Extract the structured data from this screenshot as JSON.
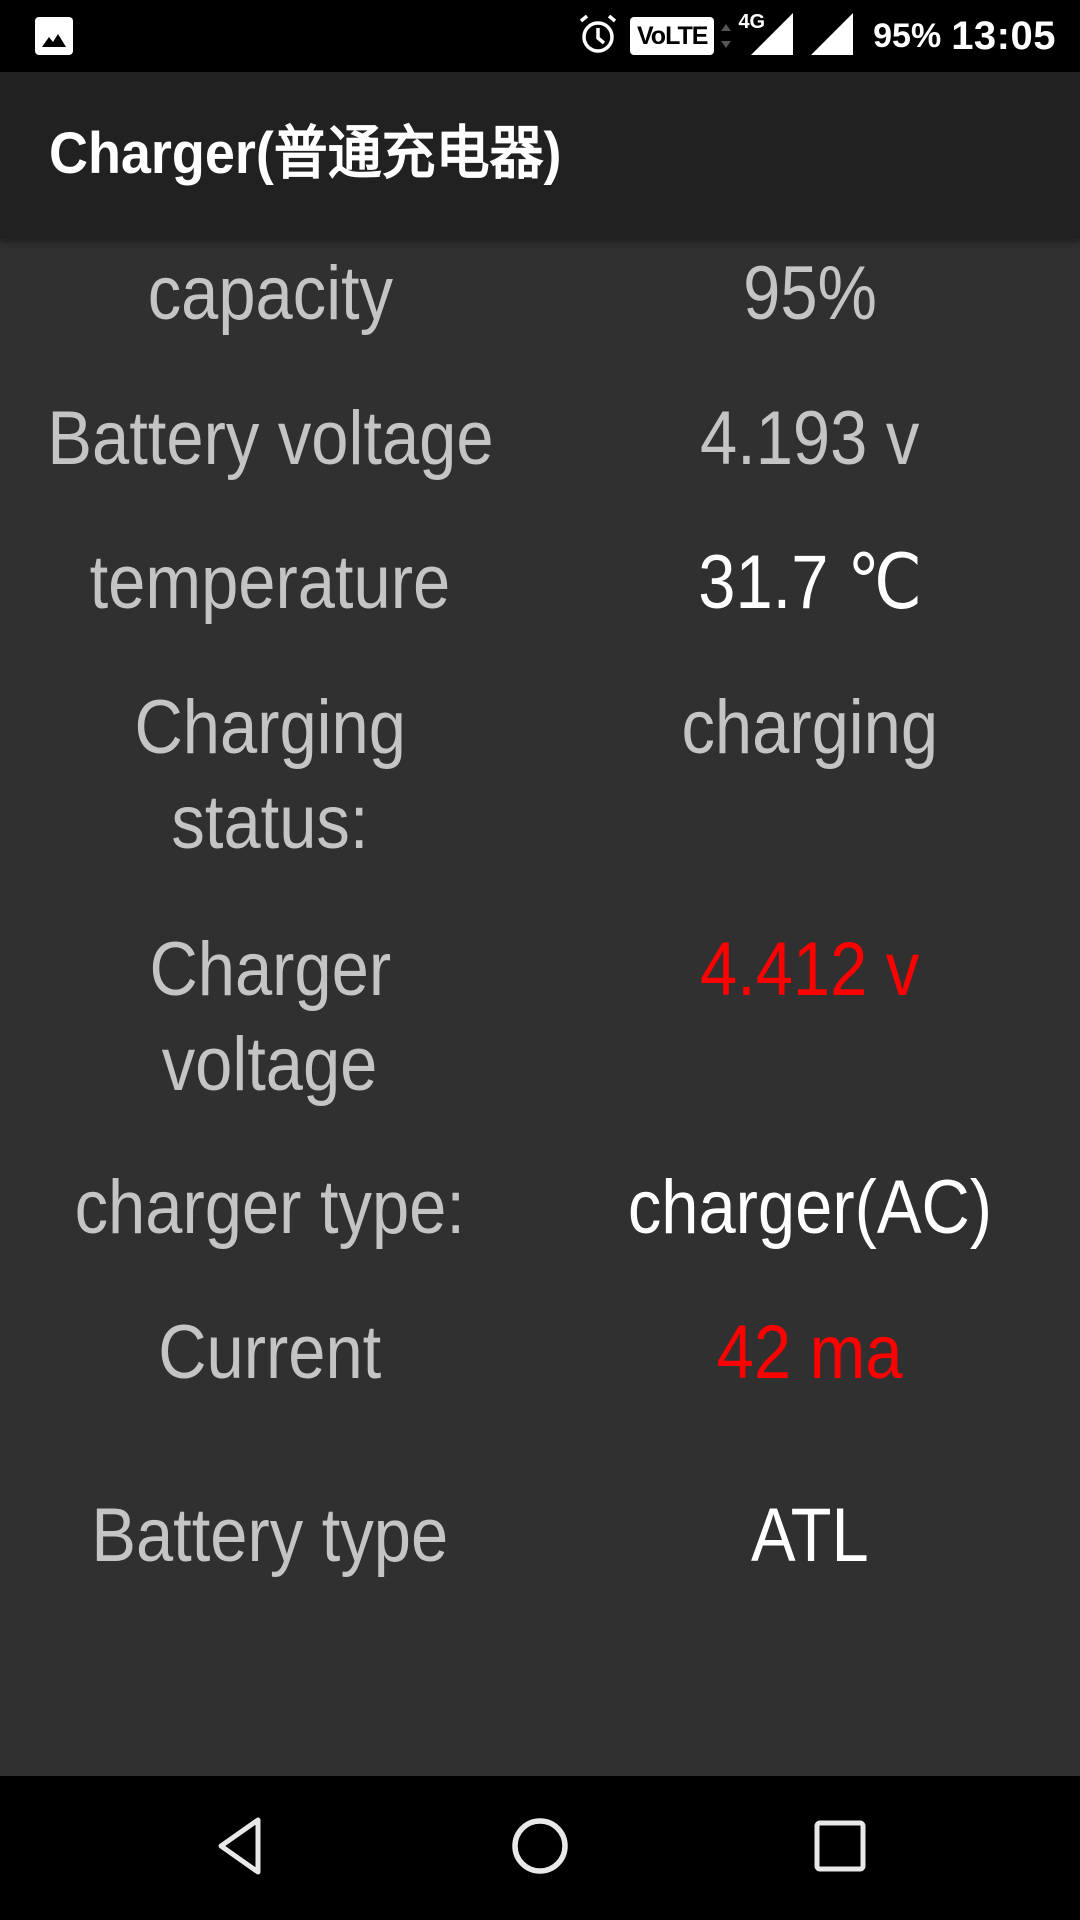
{
  "status_bar": {
    "left_icons": [
      "gallery-icon"
    ],
    "right_icons": [
      "alarm-icon",
      "volte-icon",
      "data-activity-icon",
      "signal-4g-icon",
      "signal-icon"
    ],
    "volte_label": "VoLTE",
    "network_label": "4G",
    "battery_percent": "95%",
    "time": "13:05"
  },
  "app_bar": {
    "title": "Charger(普通充电器)"
  },
  "rows": [
    {
      "label": "capacity",
      "value": "95%",
      "value_color": "gray"
    },
    {
      "label": "Battery voltage",
      "value": "4.193 v",
      "value_color": "gray"
    },
    {
      "label": "temperature",
      "value": "31.7 ℃",
      "value_color": "white"
    },
    {
      "label_lines": [
        "Charging",
        "status:"
      ],
      "value": "charging",
      "value_color": "gray"
    },
    {
      "label_lines": [
        "Charger",
        "voltage"
      ],
      "value": "4.412 v",
      "value_color": "red"
    },
    {
      "label": "charger type:",
      "value": "charger(AC)",
      "value_color": "white"
    },
    {
      "label": "Current",
      "value": "42 ma",
      "value_color": "red"
    },
    {
      "label": "Battery type",
      "value": "ATL",
      "value_color": "white"
    }
  ],
  "colors": {
    "background": "#303030",
    "app_bar": "#212121",
    "label_gray": "#c4c4c4",
    "value_white": "#ffffff",
    "warning_red": "#ff0000"
  },
  "nav_bar": {
    "buttons": [
      "back",
      "home",
      "recents"
    ]
  }
}
